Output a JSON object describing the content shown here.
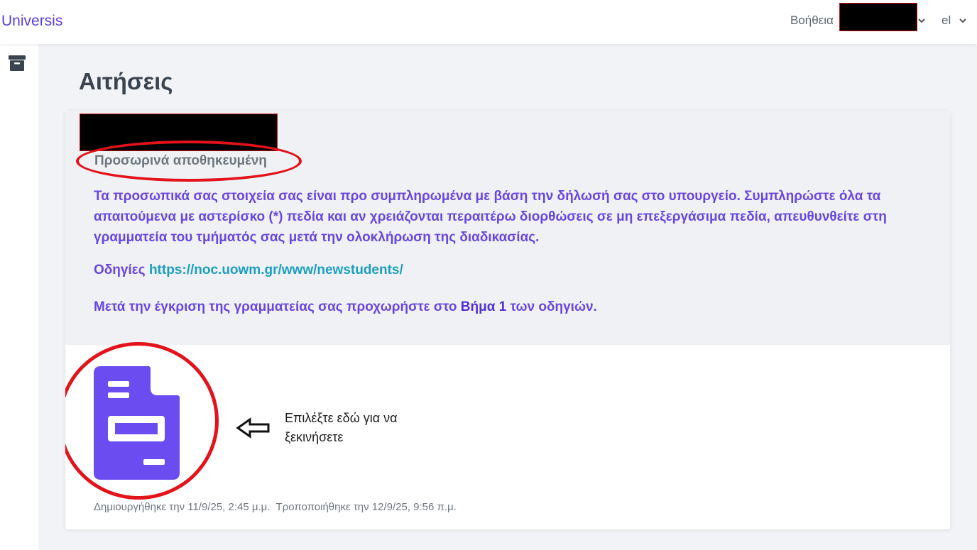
{
  "header": {
    "brand": "Universis",
    "help_label": "Βοήθεια",
    "language": "el"
  },
  "page": {
    "title": "Αιτήσεις"
  },
  "application": {
    "status": "Προσωρινά αποθηκευμένη",
    "description": "Τα προσωπικά σας στοιχεία σας είναι προ συμπληρωμένα με βάση την δήλωσή σας στο υπουργείο. Συμπληρώστε όλα τα απαιτούμενα με αστερίσκο (*) πεδία και αν χρειάζονται περαιτέρω διορθώσεις σε μη επεξεργάσιμα πεδία, απευθυνθείτε στη γραμματεία του τμήματός σας μετά την ολοκλήρωση της διαδικασίας.",
    "instructions_label": "Οδηγίες",
    "instructions_link": "https://noc.uowm.gr/www/newstudents/",
    "step_prefix": "Μετά την έγκριση της γραμματείας σας προχωρήστε στο ",
    "step_strong": "Βήμα 1",
    "step_suffix": " των οδηγιών.",
    "hint_text": "Επιλέξτε εδώ για να ξεκινήσετε",
    "meta": "Δημιουργήθηκε την 11/9/25, 2:45 μ.μ.  Τροποποιήθηκε την 12/9/25, 9:56 π.μ."
  },
  "colors": {
    "accent": "#6a47df",
    "link": "#1c9fbf",
    "highlight_ring": "#e3121b",
    "document_icon": "#6a4cf0"
  },
  "icons": [
    "archive-icon",
    "chevron-down-icon",
    "document-icon",
    "arrow-left-icon"
  ]
}
